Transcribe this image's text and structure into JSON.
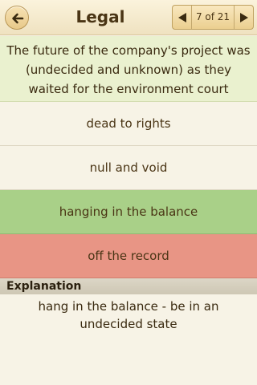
{
  "header": {
    "title": "Legal",
    "back_icon": "arrow-left-icon",
    "prev_icon": "triangle-left-icon",
    "next_icon": "triangle-right-icon",
    "counter": "7 of 21"
  },
  "question": {
    "text": "The future of the company's project was (undecided and unknown) as they waited for the environment court decision."
  },
  "answers": [
    {
      "label": "dead to rights",
      "state": "neutral"
    },
    {
      "label": "null and void",
      "state": "neutral"
    },
    {
      "label": "hanging in the balance",
      "state": "correct"
    },
    {
      "label": "off the record",
      "state": "incorrect"
    }
  ],
  "explanation": {
    "heading": "Explanation",
    "text": "hang in the balance - be in an undecided state"
  },
  "colors": {
    "correct": "#a9d088",
    "incorrect": "#e89585",
    "question_bg": "#eaf1cf",
    "background": "#f7f3e6"
  }
}
